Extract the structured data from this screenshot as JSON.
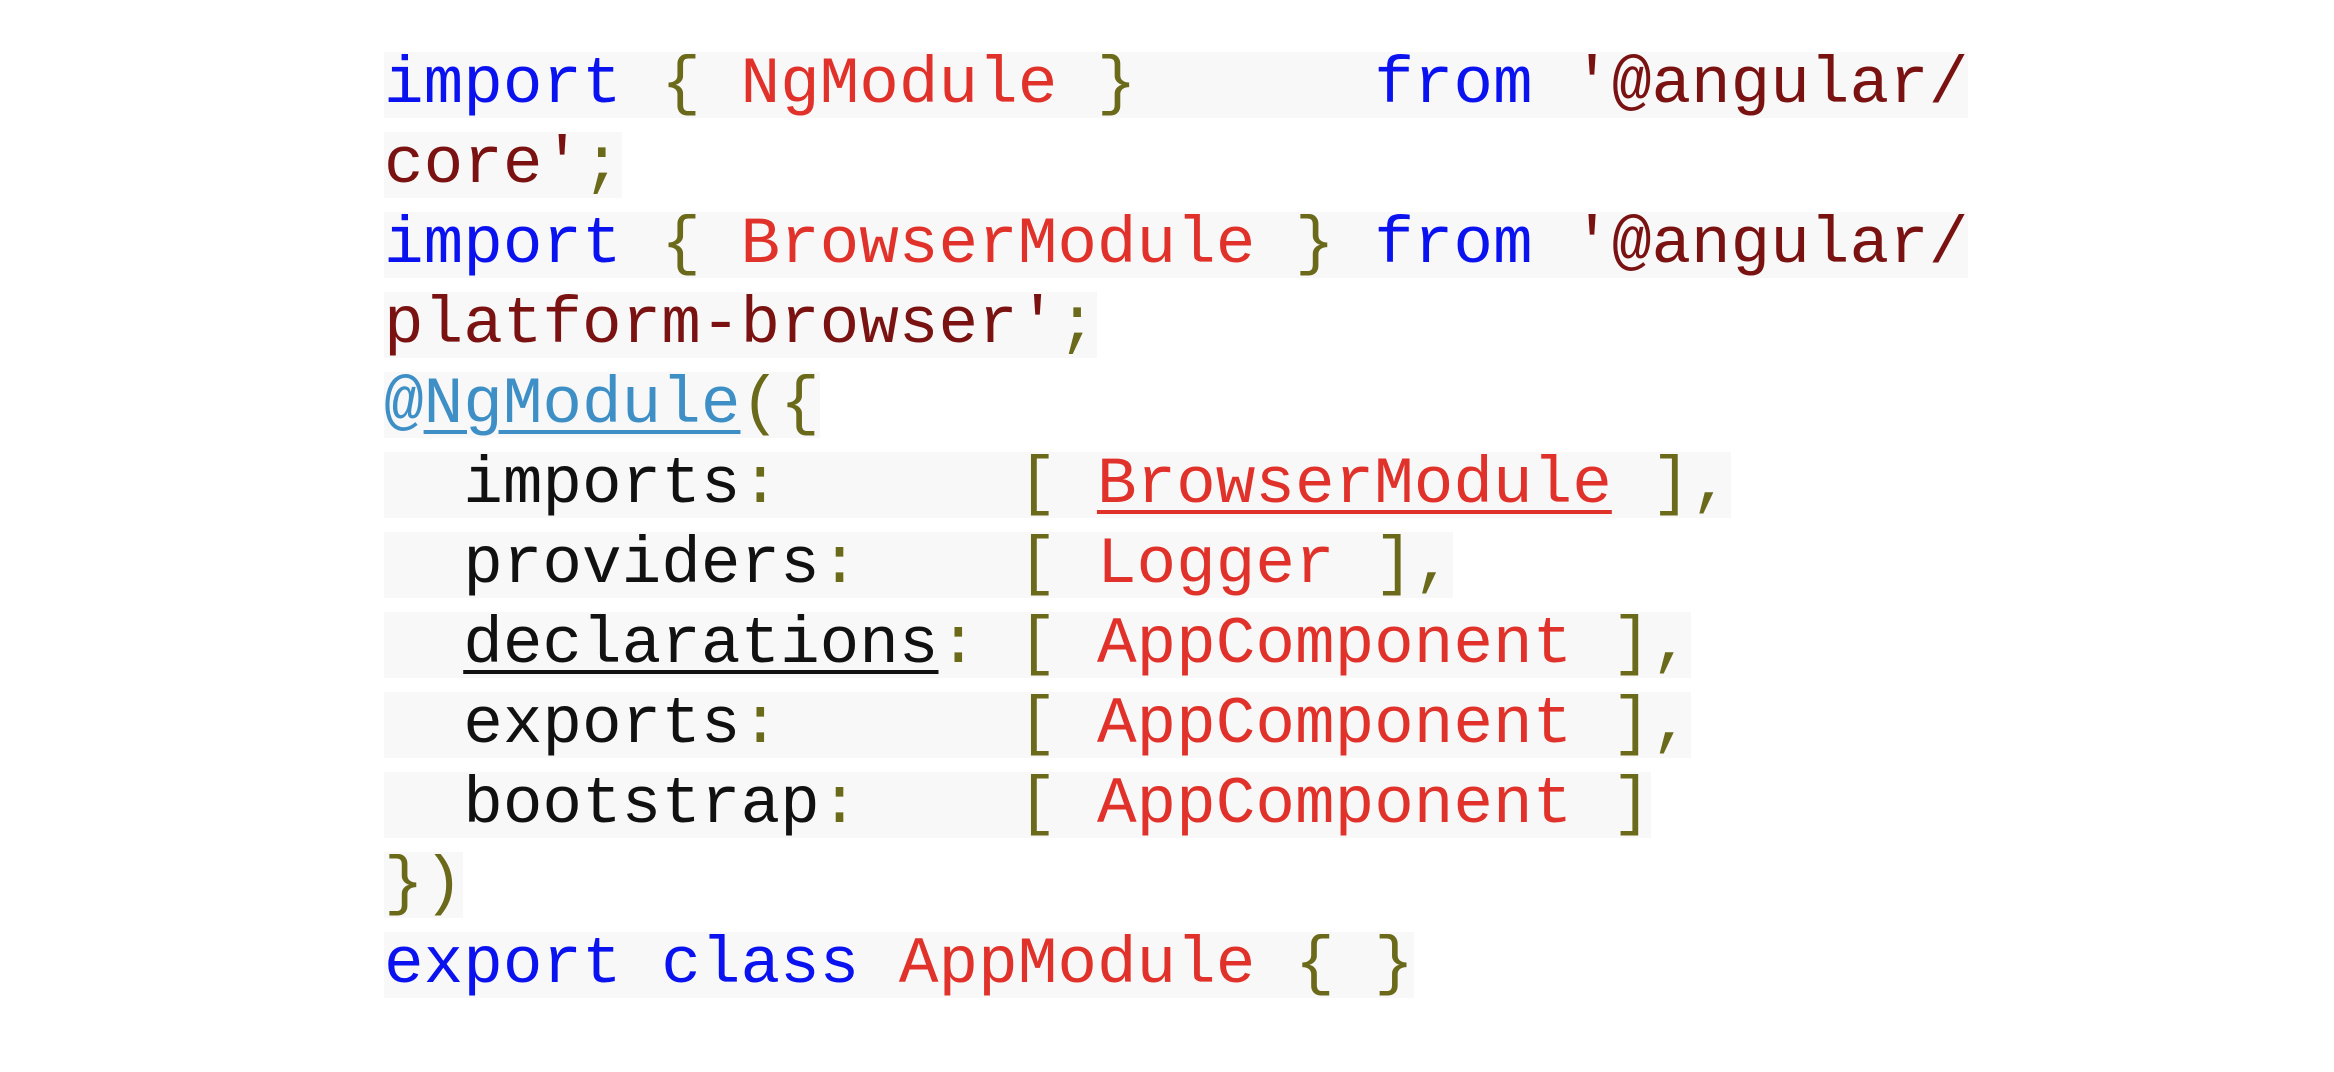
{
  "code": {
    "line1": {
      "kw_import": "import",
      "brace_open": " { ",
      "name": "NgModule",
      "brace_close": " }",
      "gap": "      ",
      "kw_from": "from",
      "space": " ",
      "str": "'@angular/"
    },
    "line2": {
      "str": "core'",
      "semi": ";"
    },
    "line3": {
      "kw_import": "import",
      "brace_open": " { ",
      "name": "BrowserModule",
      "brace_close": " } ",
      "kw_from": "from",
      "space": " ",
      "str": "'@angular/"
    },
    "line4": {
      "str": "platform-browser'",
      "semi": ";"
    },
    "line5": {
      "at": "@",
      "decorator": "NgModule",
      "open": "({"
    },
    "line6": {
      "indent": "  ",
      "prop": "imports",
      "colon": ":",
      "gap": "      ",
      "bracket_open": "[ ",
      "value": "BrowserModule",
      "bracket_close": " ],"
    },
    "line7": {
      "indent": "  ",
      "prop": "providers",
      "colon": ":",
      "gap": "    ",
      "bracket_open": "[ ",
      "value": "Logger",
      "bracket_close": " ],"
    },
    "line8": {
      "indent": "  ",
      "prop": "declarations",
      "colon": ":",
      "gap": " ",
      "bracket_open": "[ ",
      "value": "AppComponent",
      "bracket_close": " ],"
    },
    "line9": {
      "indent": "  ",
      "prop": "exports",
      "colon": ":",
      "gap": "      ",
      "bracket_open": "[ ",
      "value": "AppComponent",
      "bracket_close": " ],"
    },
    "line10": {
      "indent": "  ",
      "prop": "bootstrap",
      "colon": ":",
      "gap": "    ",
      "bracket_open": "[ ",
      "value": "AppComponent",
      "bracket_close": " ]"
    },
    "line11": {
      "close": "})"
    },
    "line12": {
      "kw_export": "export",
      "space1": " ",
      "kw_class": "class",
      "space2": " ",
      "name": "AppModule",
      "braces": " { }"
    }
  },
  "colors": {
    "keyword": "#0a12f0",
    "punctuation": "#6b6a1a",
    "identifier": "#e0322a",
    "string": "#7a1212",
    "property": "#111111",
    "decorator": "#3f8fc7",
    "line_background": "#f8f8f8"
  }
}
